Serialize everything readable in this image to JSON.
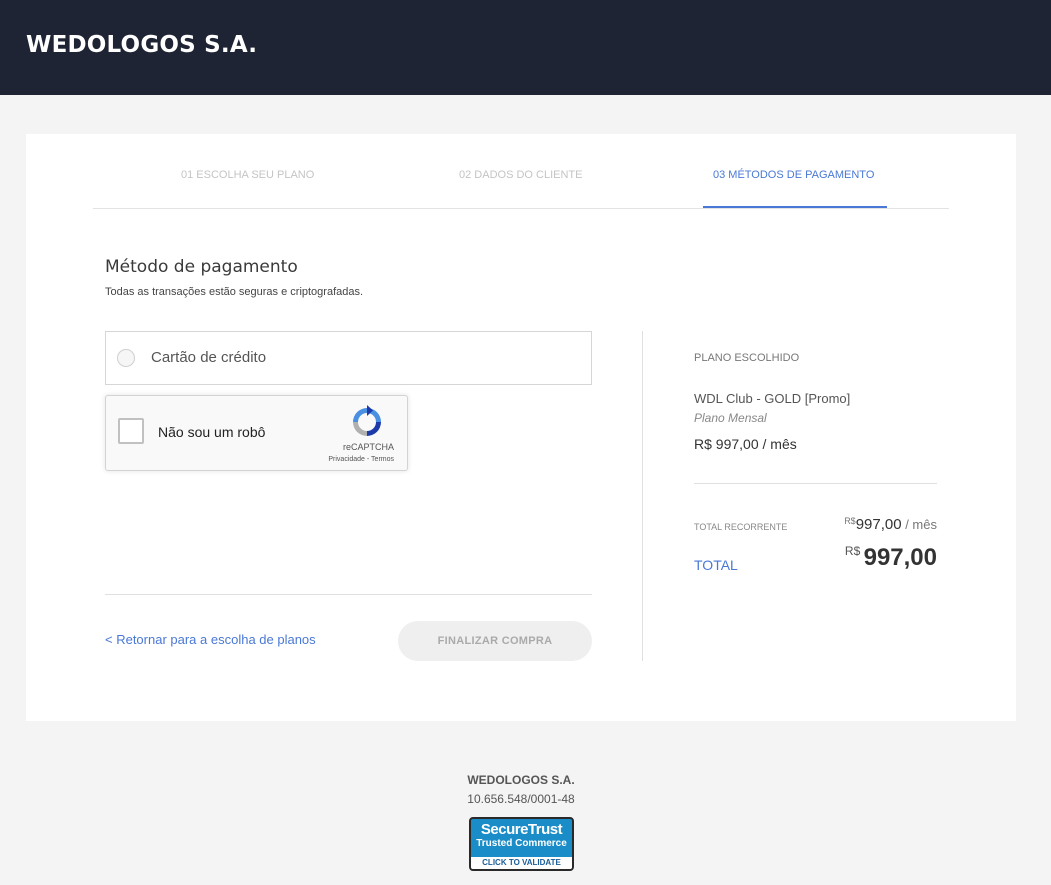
{
  "header": {
    "brand": "WEDOLOGOS S.A."
  },
  "steps": [
    {
      "label": "01 ESCOLHA SEU PLANO",
      "active": false
    },
    {
      "label": "02 DADOS DO CLIENTE",
      "active": false
    },
    {
      "label": "03 MÉTODOS DE PAGAMENTO",
      "active": true
    }
  ],
  "payment": {
    "title": "Método de pagamento",
    "subtitle": "Todas as transações estão seguras e criptografadas.",
    "option_label": "Cartão de crédito"
  },
  "recaptcha": {
    "label": "Não sou um robô",
    "brand": "reCAPTCHA",
    "links": "Privacidade - Termos"
  },
  "actions": {
    "back_link": "< Retornar para a escolha de planos",
    "finalize": "FINALIZAR COMPRA"
  },
  "summary": {
    "heading": "PLANO ESCOLHIDO",
    "plan_name": "WDL Club - GOLD [Promo]",
    "plan_cycle": "Plano Mensal",
    "plan_price": "R$ 997,00 / mês",
    "recurring_label": "TOTAL RECORRENTE",
    "recurring_currency": "R$",
    "recurring_amount": "997,00",
    "recurring_period": " / mês",
    "total_label": "TOTAL",
    "total_currency": "R$ ",
    "total_amount": "997,00"
  },
  "footer": {
    "company": "WEDOLOGOS S.A.",
    "cnpj": "10.656.548/0001-48",
    "badge_line1": "SecureTrust",
    "badge_line2": "Trusted Commerce",
    "badge_line3": "CLICK TO VALIDATE"
  },
  "colors": {
    "header_bg": "#1e2433",
    "accent": "#4a78d6",
    "page_bg": "#f4f4f4"
  }
}
